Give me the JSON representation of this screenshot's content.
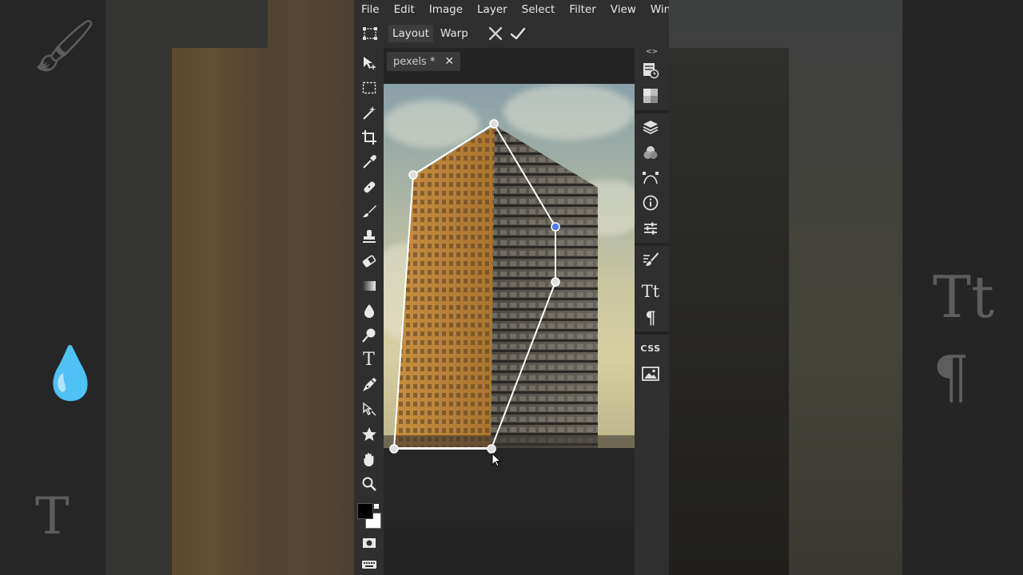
{
  "menu": [
    "File",
    "Edit",
    "Image",
    "Layer",
    "Select",
    "Filter",
    "View",
    "Window"
  ],
  "options": {
    "layout_label": "Layout",
    "warp_label": "Warp"
  },
  "document": {
    "tab_label": "pexels *"
  },
  "right_panel": {
    "collapse_label": "<>",
    "css_label": "CSS"
  },
  "colors": {
    "foreground": "#000000",
    "background": "#ffffff",
    "accent_point": "#4a7de8"
  },
  "icons": {
    "tools": [
      "move-icon",
      "marquee-icon",
      "magic-wand-icon",
      "crop-icon",
      "eyedropper-icon",
      "healing-icon",
      "brush-icon",
      "stamp-icon",
      "eraser-icon",
      "gradient-icon",
      "blur-icon",
      "dodge-icon",
      "type-icon",
      "pen-icon",
      "path-select-icon",
      "shape-icon",
      "hand-icon",
      "zoom-icon"
    ]
  }
}
